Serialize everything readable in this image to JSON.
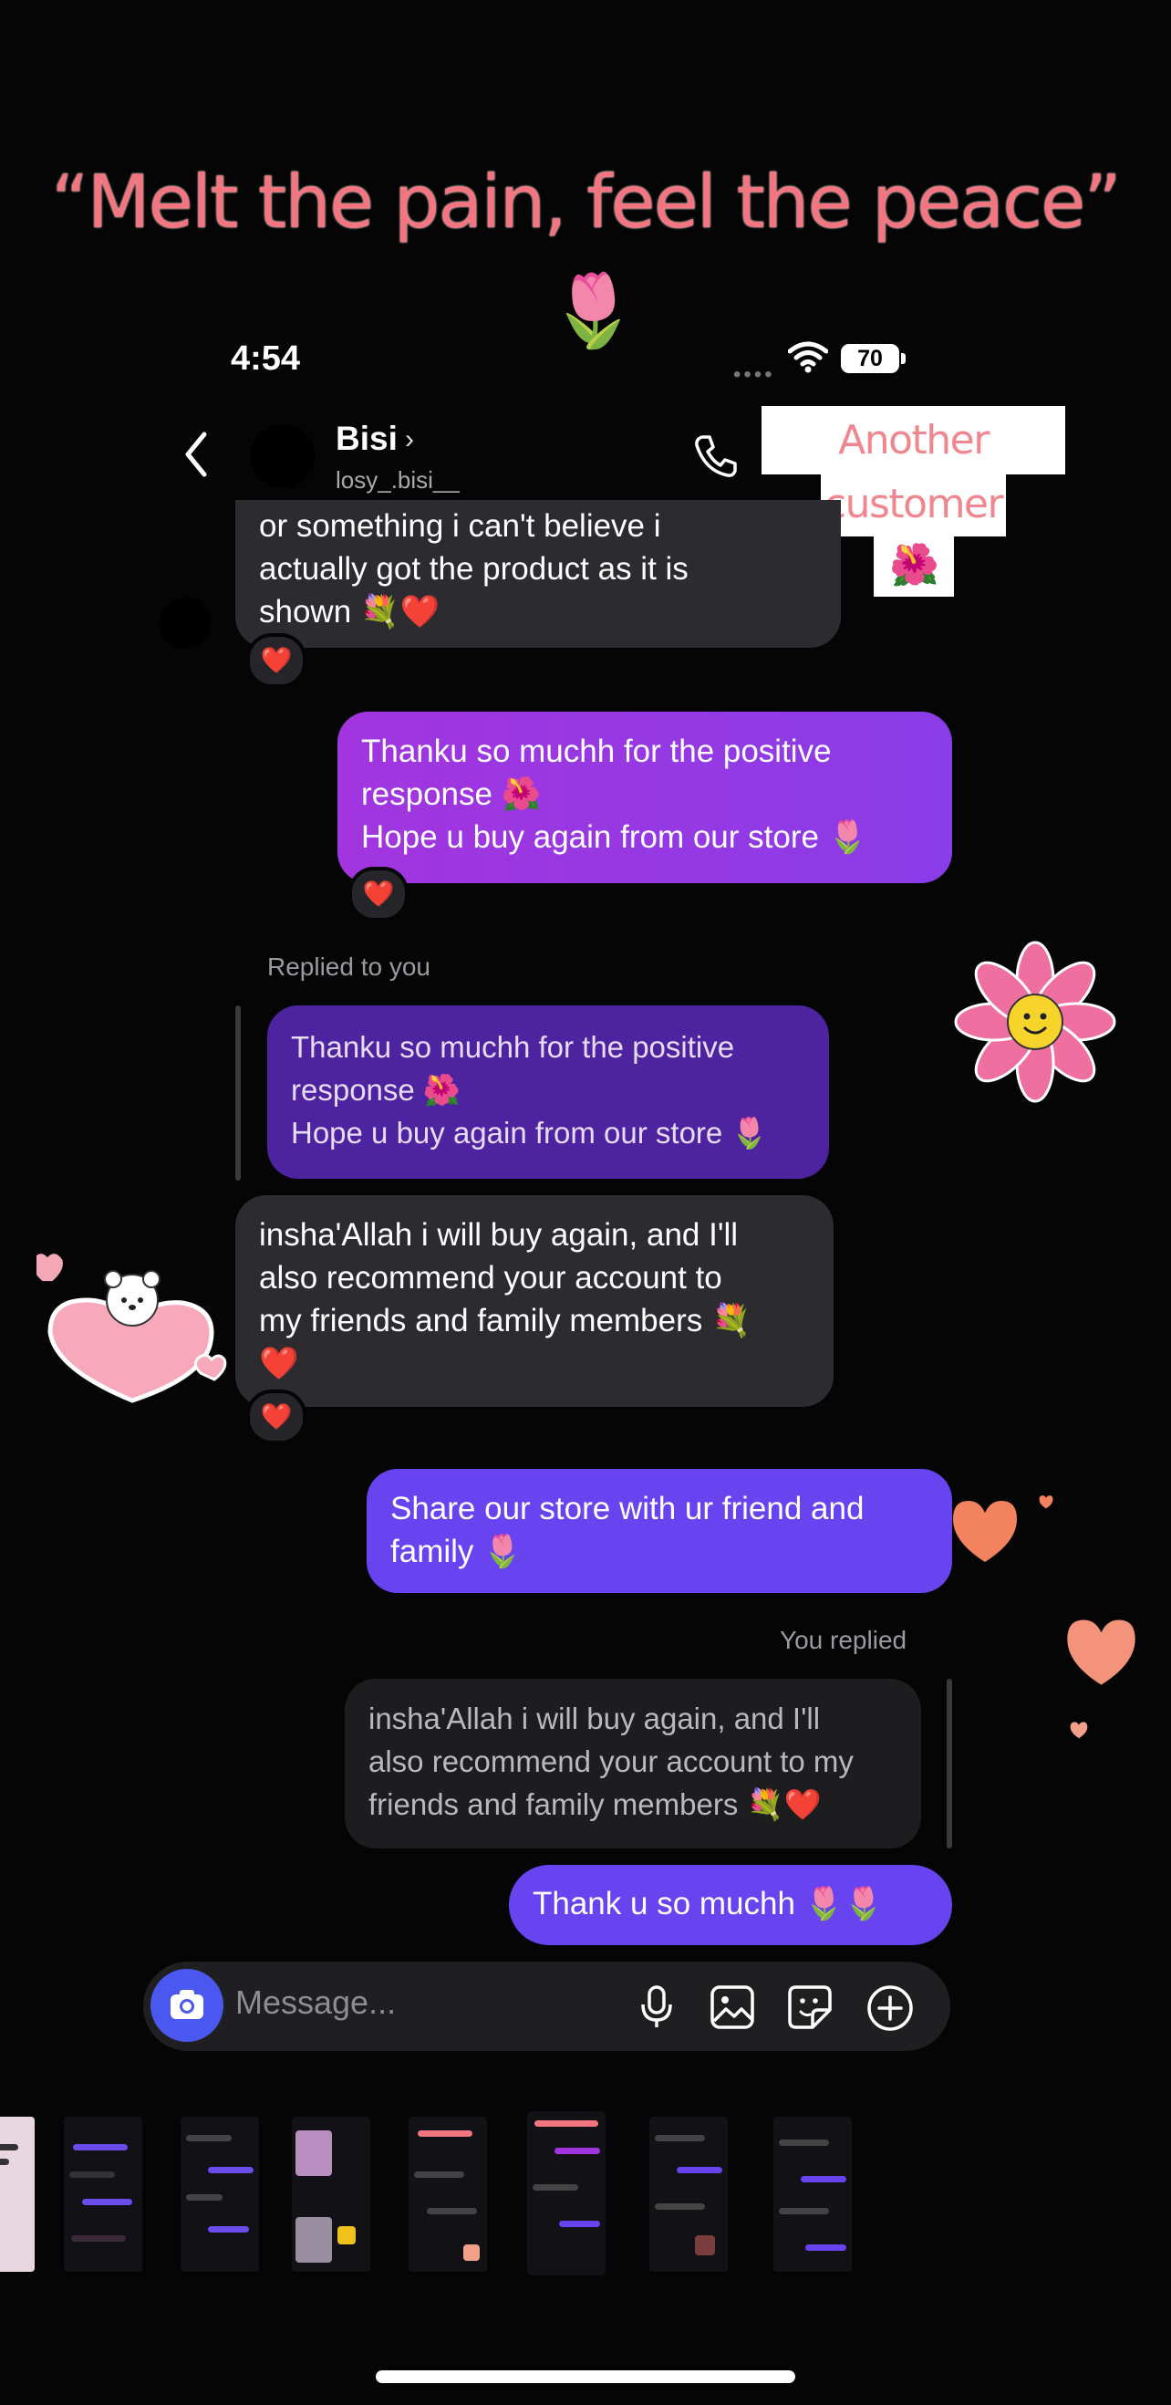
{
  "caption": "“Melt the pain, feel the peace”",
  "caption_emoji": "🌷",
  "status": {
    "time": "4:54",
    "battery": "70"
  },
  "header": {
    "name": "Bisi",
    "handle": "losy_.bisi__"
  },
  "sticker": {
    "line1": "Another satisfied",
    "line2": "customer",
    "emoji": "🌺"
  },
  "messages": {
    "m1_text": "or something i can't believe i\nactually got the product as it is\nshown 💐❤️",
    "m1_reaction": "❤️",
    "m2_text": "Thanku so muchh for the positive\nresponse 🌺\nHope u buy again from our store 🌷",
    "m2_reaction": "❤️",
    "replied_label": "Replied to you",
    "quote1_text": "Thanku so muchh for the positive\nresponse 🌺\nHope u buy again from our store 🌷",
    "m3_text": "insha'Allah i will buy again, and I'll\nalso recommend your account to\nmy friends and family members 💐\n❤️",
    "m3_reaction": "❤️",
    "m4_text": "Share our store with ur friend and\nfamily 🌷",
    "you_replied_label": "You replied",
    "quote2_text": "insha'Allah i will buy again, and I'll\nalso recommend your account to my\nfriends and family members 💐❤️",
    "m5_text": "Thank u so muchh 🌷🌷"
  },
  "composer": {
    "placeholder": "Message..."
  },
  "icons": [
    "back-icon",
    "phone-icon",
    "camera-icon",
    "microphone-icon",
    "gallery-icon",
    "sticker-icon",
    "plus-icon",
    "wifi-icon"
  ],
  "colors": {
    "caption": "#f2757f",
    "outgoing_purple": "#a235df",
    "outgoing_violet": "#6744f0",
    "incoming_gray": "#2c2c30"
  }
}
